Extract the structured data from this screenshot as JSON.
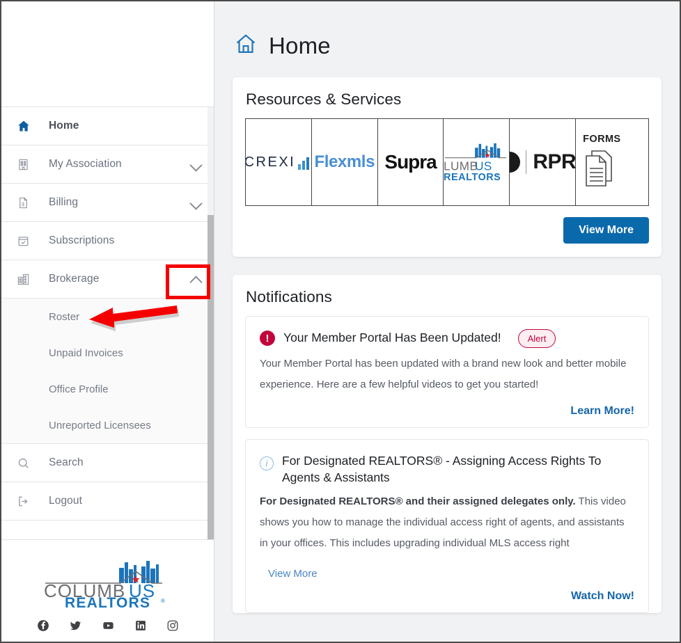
{
  "page": {
    "title": "Home",
    "home_icon": "home-outline-icon",
    "cursor_icon": "mouse-pointer-icon"
  },
  "sidebar": {
    "items": [
      {
        "label": "Home",
        "icon": "home-filled-icon",
        "active": true,
        "expandable": false
      },
      {
        "label": "My Association",
        "icon": "building-icon",
        "active": false,
        "expandable": true,
        "expanded": false
      },
      {
        "label": "Billing",
        "icon": "invoice-dollar-icon",
        "active": false,
        "expandable": true,
        "expanded": false
      },
      {
        "label": "Subscriptions",
        "icon": "calendar-check-icon",
        "active": false,
        "expandable": false
      },
      {
        "label": "Brokerage",
        "icon": "office-blocks-icon",
        "active": false,
        "expandable": true,
        "expanded": true
      }
    ],
    "submenu": [
      {
        "label": "Roster"
      },
      {
        "label": "Unpaid Invoices"
      },
      {
        "label": "Office Profile"
      },
      {
        "label": "Unreported Licensees"
      }
    ],
    "footer_items": [
      {
        "label": "Search",
        "icon": "search-icon"
      },
      {
        "label": "Logout",
        "icon": "logout-icon"
      }
    ],
    "logo": {
      "line1": "COLUMB",
      "line1_accent": "US",
      "line2": "REALTORS",
      "registered": "®",
      "alt": "columbus-realtors-logo"
    },
    "social": [
      {
        "name": "facebook-icon"
      },
      {
        "name": "twitter-icon"
      },
      {
        "name": "youtube-icon"
      },
      {
        "name": "linkedin-icon"
      },
      {
        "name": "instagram-icon"
      }
    ]
  },
  "resources": {
    "title": "Resources & Services",
    "tiles": [
      {
        "name": "crexi-logo",
        "label": "CREXI"
      },
      {
        "name": "flexmls-logo",
        "label": "Flexmls"
      },
      {
        "name": "supra-logo",
        "label": "Supra"
      },
      {
        "name": "columbus-realtors-logo",
        "label": "LUMBUS",
        "sub": "REALTORS"
      },
      {
        "name": "rpr-logo",
        "label": "RPR"
      },
      {
        "name": "forms-logo",
        "label": "FORMS"
      }
    ],
    "view_more_label": "View More"
  },
  "notifications": {
    "title": "Notifications",
    "items": [
      {
        "icon": "alert-exclamation-icon",
        "title": "Your Member Portal Has Been Updated!",
        "badge": "Alert",
        "body": "Your Member Portal has been updated with a brand new look and better mobile experience. Here are a few helpful videos to get you started!",
        "action": "Learn More!"
      },
      {
        "icon": "info-circle-icon",
        "title": "For Designated REALTORS® - Assigning Access Rights To Agents & Assistants",
        "body_bold": "For Designated REALTORS® and their assigned delegates only.",
        "body": " This video shows you how to manage the individual access right of agents, and assistants in your offices. This includes upgrading individual MLS access right",
        "view_more": "View More",
        "action": "Watch Now!"
      }
    ]
  },
  "annotations": {
    "highlight_rect": "brokerage-chevron-highlight",
    "arrow": "roster-pointer-arrow",
    "color": "#f50000"
  },
  "colors": {
    "accent_blue": "#0a69ab",
    "link_blue": "#1565a8",
    "alert_red": "#c2043d",
    "brand_blue": "#1b75bb",
    "annotation_red": "#f50000"
  }
}
